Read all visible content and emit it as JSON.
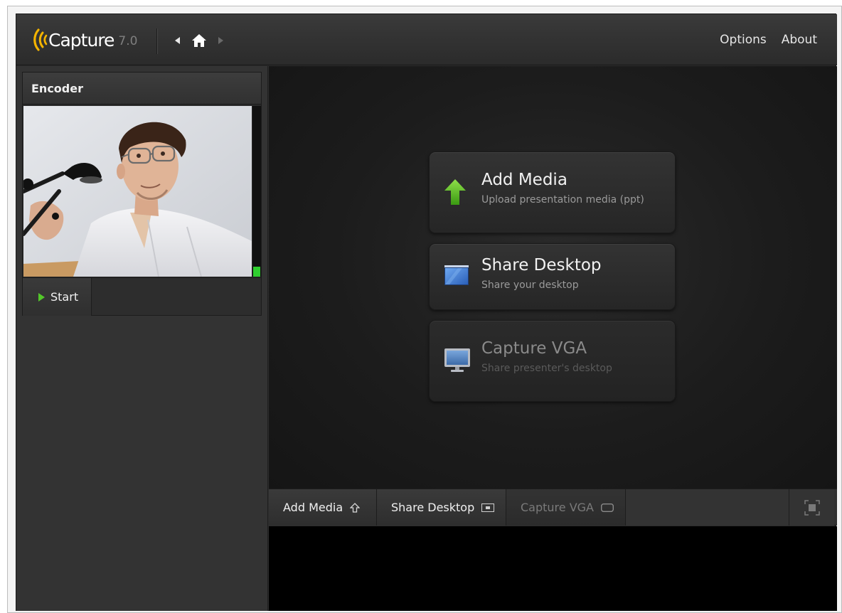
{
  "header": {
    "app_name": "Capture",
    "version": "7.0",
    "nav": {
      "back_icon": "arrow-left-icon",
      "home_icon": "home-icon",
      "forward_icon": "arrow-right-icon"
    },
    "links": [
      "Options",
      "About"
    ]
  },
  "sidebar": {
    "encoder": {
      "title": "Encoder",
      "audio_level_fraction": 0.06,
      "start_label": "Start"
    }
  },
  "main": {
    "cards": [
      {
        "title": "Add Media",
        "subtitle": "Upload presentation media (ppt)",
        "icon": "upload-arrow-icon",
        "enabled": true
      },
      {
        "title": "Share Desktop",
        "subtitle": "Share your desktop",
        "icon": "desktop-window-icon",
        "enabled": true
      },
      {
        "title": "Capture VGA",
        "subtitle": "Share presenter's desktop",
        "icon": "monitor-icon",
        "enabled": false
      }
    ]
  },
  "toolbar": {
    "tabs": [
      {
        "label": "Add Media",
        "icon": "upload-outline-icon",
        "enabled": true
      },
      {
        "label": "Share Desktop",
        "icon": "window-icon",
        "enabled": true
      },
      {
        "label": "Capture VGA",
        "icon": "monitor-outline-icon",
        "enabled": false
      }
    ],
    "fullscreen_icon": "fullscreen-icon"
  },
  "colors": {
    "accent_logo": "#f5b400",
    "level_meter": "#2fcf2f",
    "play_icon": "#53c72a",
    "upload_arrow": "#4fb81e",
    "desktop_blue": "#3f7fd8"
  }
}
